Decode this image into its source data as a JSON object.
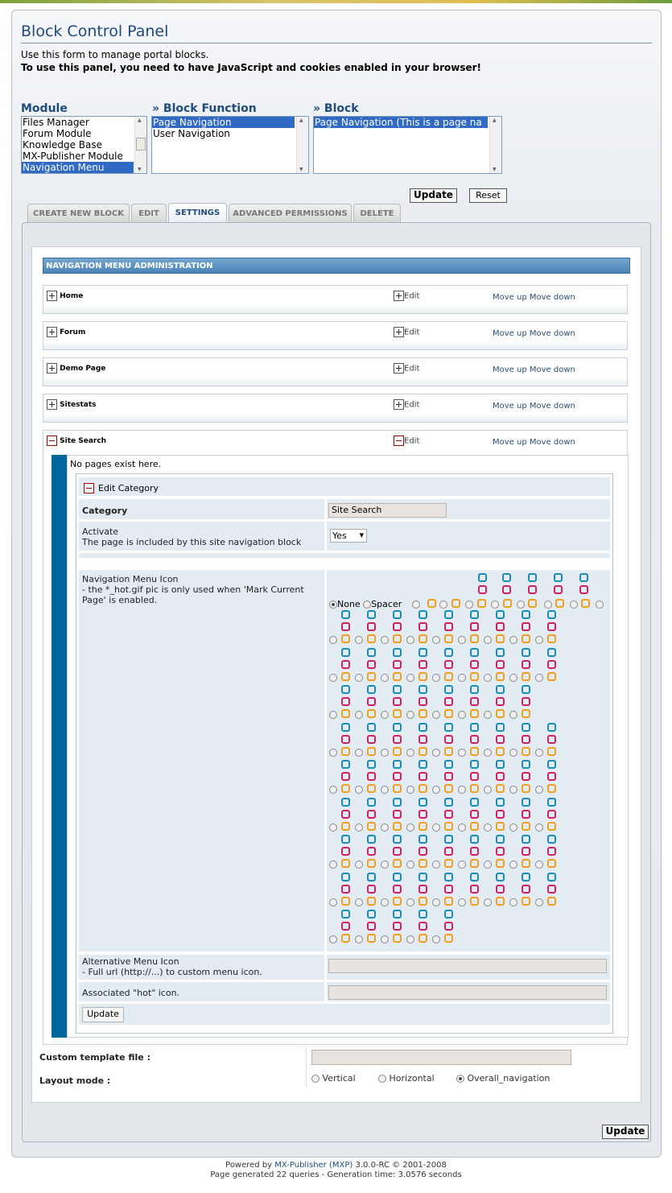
{
  "header": {
    "title": "Block Control Panel",
    "desc": "Use this form to manage portal blocks.",
    "warning": "To use this panel, you need to have JavaScript and cookies enabled in your browser!"
  },
  "module": {
    "label": "Module",
    "items": [
      "Files Manager",
      "Forum Module",
      "Knowledge Base",
      "MX-Publisher Module",
      "Navigation Menu"
    ],
    "selected": "Navigation Menu"
  },
  "block_function": {
    "label": "» Block Function",
    "items": [
      "Page Navigation",
      "User Navigation"
    ],
    "selected": "Page Navigation"
  },
  "block": {
    "label": "» Block",
    "items": [
      "Page Navigation (This is a page na"
    ],
    "selected": "Page Navigation (This is a page na"
  },
  "buttons": {
    "update": "Update",
    "reset": "Reset"
  },
  "tabs": [
    "CREATE NEW BLOCK",
    "EDIT",
    "SETTINGS",
    "ADVANCED PERMISSIONS",
    "DELETE"
  ],
  "active_tab": "SETTINGS",
  "nav_admin": {
    "title": "NAVIGATION MENU ADMINISTRATION",
    "edit_label": "Edit",
    "move_up": "Move up",
    "move_down": "Move down",
    "categories": [
      {
        "name": "Home",
        "expanded": false
      },
      {
        "name": "Forum",
        "expanded": false
      },
      {
        "name": "Demo Page",
        "expanded": false
      },
      {
        "name": "Sitestats",
        "expanded": false
      },
      {
        "name": "Site Search",
        "expanded": true
      }
    ]
  },
  "edit_category": {
    "empty_msg": "No pages exist here.",
    "title": "Edit Category",
    "category_label": "Category",
    "category_value": "Site Search",
    "activate_label": "Activate",
    "activate_desc": "The page is included by this site navigation block",
    "activate_value": "Yes",
    "icon_label": "Navigation Menu Icon",
    "icon_desc": "- the *_hot.gif pic is only used when 'Mark Current Page' is enabled.",
    "icon_none": "None",
    "icon_spacer": "Spacer",
    "icon_selected": "None",
    "alt_label": "Alternative Menu Icon",
    "alt_desc": "- Full url (http://...) to custom menu icon.",
    "alt_value": "",
    "hot_label": "Associated \"hot\" icon.",
    "hot_value": "",
    "update": "Update"
  },
  "settings": {
    "template_label": "Custom template file :",
    "template_value": "",
    "layout_label": "Layout mode :",
    "layout_options": [
      "Vertical",
      "Horizontal",
      "Overall_navigation"
    ],
    "layout_selected": "Overall_navigation"
  },
  "footer": {
    "powered_prefix": "Powered by",
    "powered_link": "MX-Publisher (MXP)",
    "powered_suffix": "3.0.0-RC © 2001-2008",
    "stats": "Page generated 22 queries - Generation time: 3.0576 seconds"
  },
  "icon_colors": {
    "blue": "#1a8cb8",
    "red": "#d02060",
    "orange": "#f0a020",
    "black": "#111111"
  }
}
